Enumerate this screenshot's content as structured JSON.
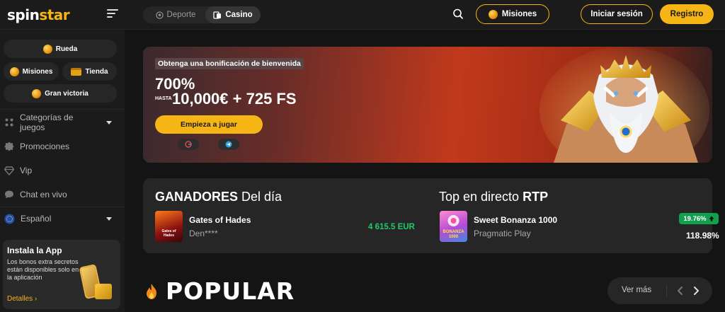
{
  "header": {
    "logo_main": "spin",
    "logo_accent": "star",
    "tabs": [
      {
        "label": "Deporte",
        "icon": "soccer-ball-icon",
        "active": false
      },
      {
        "label": "Casino",
        "icon": "casino-icon",
        "active": true
      }
    ],
    "missions_label": "Misiones",
    "login_label": "Iniciar sesión",
    "register_label": "Registro"
  },
  "sidebar": {
    "quick": [
      {
        "label": "Rueda",
        "icon": "wheel-icon"
      },
      {
        "label": "Misiones",
        "icon": "coin-icon"
      },
      {
        "label": "Tienda",
        "icon": "chest-icon"
      },
      {
        "label": "Gran victoria",
        "icon": "trophy-coin-icon"
      }
    ],
    "nav": [
      {
        "label": "Categorías de juegos",
        "icon": "categories-icon",
        "has_caret": true
      },
      {
        "label": "Promociones",
        "icon": "promotions-icon"
      },
      {
        "label": "Vip",
        "icon": "diamond-icon"
      },
      {
        "label": "Chat en vivo",
        "icon": "chat-icon"
      },
      {
        "label": "Español",
        "icon": "eu-flag-icon",
        "has_caret": true
      }
    ],
    "app": {
      "title": "Instala la App",
      "desc": "Los bonos extra secretos están disponibles solo en la aplicación",
      "link": "Detalles ›"
    }
  },
  "banner": {
    "tag": "Obtenga una bonificación de bienvenida",
    "percent": "700%",
    "hasta": "HASTA",
    "amount": "10,000€ + 725 FS",
    "cta": "Empieza a jugar",
    "social": [
      "google-icon",
      "telegram-icon"
    ]
  },
  "winners": {
    "title_bold": "GANADORES",
    "title_rest": " Del día",
    "game": "Gates of Hades",
    "user": "Den****",
    "amount": "4 615.5 EUR",
    "thumb_label": "Gates of Hades"
  },
  "rtp": {
    "title_rest": "Top en directo ",
    "title_bold": "RTP",
    "game": "Sweet Bonanza 1000",
    "provider": "Pragmatic Play",
    "change": "19.76%",
    "value": "118.98%",
    "thumb_label": "BONANZA 1000"
  },
  "popular": {
    "title": "POPULAR",
    "see_more": "Ver más"
  },
  "colors": {
    "accent": "#f5b514",
    "positive": "#1fc96a",
    "panel": "#262626"
  }
}
